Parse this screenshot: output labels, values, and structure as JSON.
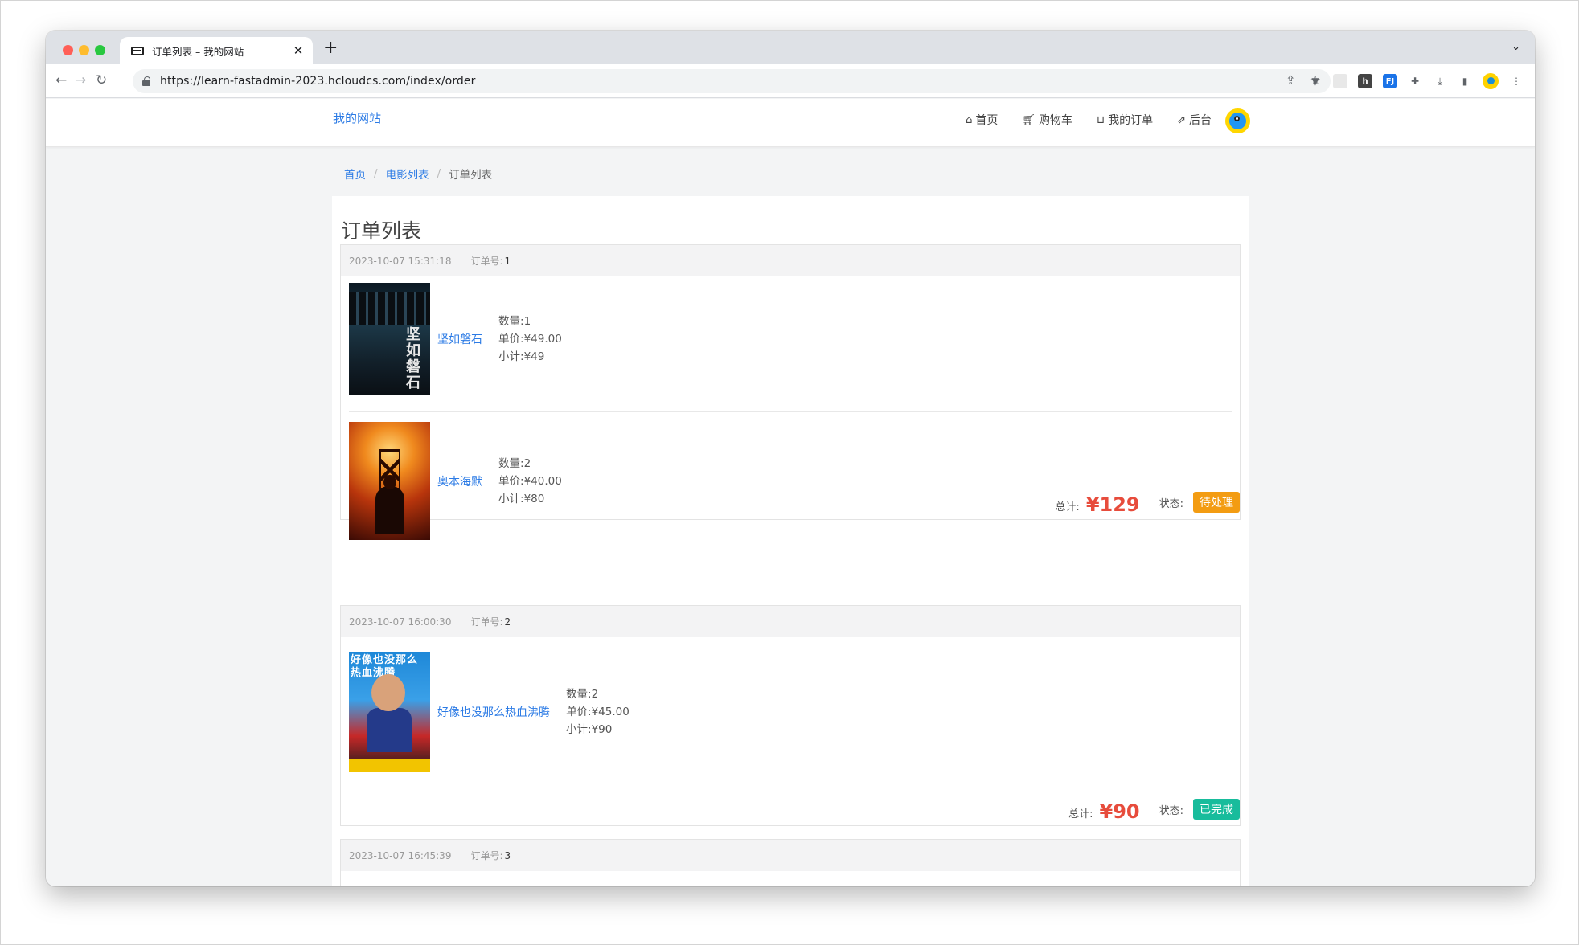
{
  "browser": {
    "tab_title": "订单列表 – 我的网站",
    "tab_close": "✕",
    "new_tab": "+",
    "url": "https://learn-fastadmin-2023.hcloudcs.com/index/order"
  },
  "site": {
    "brand": "我的网站",
    "nav": [
      {
        "icon": "home-icon",
        "label": "首页"
      },
      {
        "icon": "cart-icon",
        "label": "购物车"
      },
      {
        "icon": "basket-icon",
        "label": "我的订单"
      },
      {
        "icon": "external-link-icon",
        "label": "后台"
      }
    ]
  },
  "breadcrumb": [
    "首页",
    "电影列表",
    "订单列表"
  ],
  "page_title": "订单列表",
  "labels": {
    "order_no": "订单号:",
    "qty": "数量:",
    "price": "单价:",
    "subtotal": "小计:",
    "total": "总计:",
    "status": "状态:"
  },
  "orders": [
    {
      "time": "2023-10-07 15:31:18",
      "no": "1",
      "items": [
        {
          "title": "坚如磐石",
          "qty": "1",
          "price": "¥49.00",
          "subtotal": "¥49"
        },
        {
          "title": "奥本海默",
          "qty": "2",
          "price": "¥40.00",
          "subtotal": "¥80"
        }
      ],
      "total": "¥129",
      "status": "待处理",
      "status_color": "#f39c12"
    },
    {
      "time": "2023-10-07 16:00:30",
      "no": "2",
      "items": [
        {
          "title": "好像也没那么热血沸腾",
          "qty": "2",
          "price": "¥45.00",
          "subtotal": "¥90"
        }
      ],
      "total": "¥90",
      "status": "已完成",
      "status_color": "#18bc9c"
    },
    {
      "time": "2023-10-07 16:45:39",
      "no": "3"
    }
  ],
  "poster_text": {
    "p1": "坚如磐石",
    "p3": "好像也没那么热血沸腾"
  },
  "colors": {
    "link": "#2c7be5",
    "total": "#e74c3c"
  }
}
